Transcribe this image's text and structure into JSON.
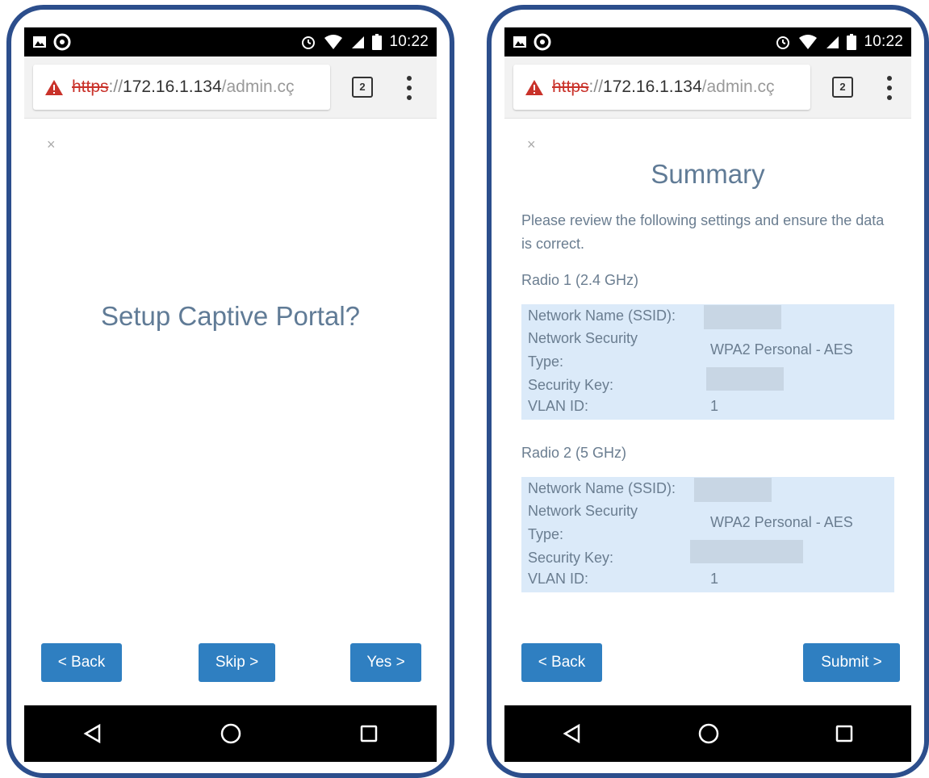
{
  "status_bar": {
    "time": "10:22"
  },
  "browser": {
    "url_scheme": "https",
    "url_sep": "://",
    "url_host": "172.16.1.134",
    "url_path": "/admin.cç",
    "tab_count": "2"
  },
  "captive_screen": {
    "close_glyph": "×",
    "title": "Setup Captive Portal?",
    "back_label": "< Back",
    "skip_label": "Skip >",
    "yes_label": "Yes >"
  },
  "summary_screen": {
    "close_glyph": "×",
    "title": "Summary",
    "intro": "Please review the following settings and ensure the data is correct.",
    "radio1": {
      "heading": "Radio 1 (2.4 GHz)",
      "ssid_label": "Network Name (SSID):",
      "security_label_1": "Network Security",
      "security_label_2": "Type:",
      "security_value": "WPA2 Personal - AES",
      "key_label": "Security Key:",
      "vlan_label": "VLAN ID:",
      "vlan_value": "1"
    },
    "radio2": {
      "heading": "Radio 2 (5 GHz)",
      "ssid_label": "Network Name (SSID):",
      "security_label_1": "Network Security",
      "security_label_2": "Type:",
      "security_value": "WPA2 Personal - AES",
      "key_label": "Security Key:",
      "vlan_label": "VLAN ID:",
      "vlan_value": "1"
    },
    "back_label": "< Back",
    "submit_label": "Submit >"
  },
  "icons": {
    "status_left": [
      "image-icon",
      "sync-icon"
    ],
    "status_right": [
      "alarm-icon",
      "wifi-icon",
      "signal-icon",
      "battery-icon"
    ],
    "browser": [
      "warning-icon",
      "tab-switcher-icon",
      "menu-icon"
    ],
    "nav": [
      "back-triangle-icon",
      "home-circle-icon",
      "recents-square-icon"
    ]
  },
  "colors": {
    "phone_border": "#2c4e8c",
    "button": "#2f7fc1",
    "title_text": "#607b96",
    "box_fill": "#dbeaf9",
    "warning": "#c9322a"
  }
}
